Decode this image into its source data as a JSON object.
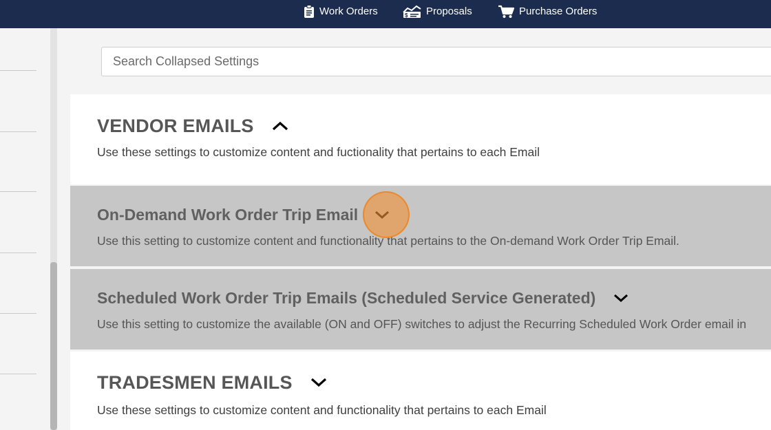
{
  "topnav": {
    "items": [
      {
        "label": "Work Orders",
        "icon": "clipboard-icon"
      },
      {
        "label": "Proposals",
        "icon": "proposal-icon"
      },
      {
        "label": "Purchase Orders",
        "icon": "cart-icon"
      }
    ]
  },
  "search": {
    "placeholder": "Search Collapsed Settings",
    "value": ""
  },
  "sections": [
    {
      "title": "VENDOR EMAILS",
      "description": "Use these settings to customize content and fuctionality that pertains to each Email",
      "expanded": true
    },
    {
      "title": "On-Demand Work Order Trip Email",
      "description": "Use this setting to customize content and functionality that pertains to the On-demand Work Order Trip Email.",
      "expanded": false
    },
    {
      "title": "Scheduled Work Order Trip Emails (Scheduled Service Generated)",
      "description": "Use this setting to customize the available (ON and OFF) switches to adjust the Recurring Scheduled Work Order email in",
      "expanded": false
    },
    {
      "title": "TRADESMEN EMAILS",
      "description": "Use these settings to customize content and functionality that pertains to each Email",
      "expanded": false
    }
  ],
  "colors": {
    "topbar": "#1b2c4f",
    "accent_click": "#f18f37",
    "collapsed_panel": "#c6c6c6"
  }
}
